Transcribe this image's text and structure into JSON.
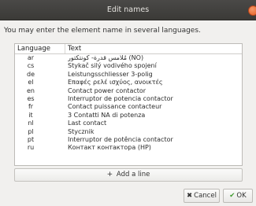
{
  "window": {
    "title": "Edit names"
  },
  "prompt": "You may enter the element name in several languages.",
  "table": {
    "headers": {
      "language": "Language",
      "text": "Text"
    },
    "rows": [
      {
        "lang": "ar",
        "text": "مُلامس قدرة- كونتكتور (NO)"
      },
      {
        "lang": "cs",
        "text": "Stykač silý vodivého spojení"
      },
      {
        "lang": "de",
        "text": "Leistungsschliesser 3-polig"
      },
      {
        "lang": "el",
        "text": "Επαφές ρελέ ισχύος, ανοικτές"
      },
      {
        "lang": "en",
        "text": "Contact power contactor"
      },
      {
        "lang": "es",
        "text": "Interruptor de potencia contactor"
      },
      {
        "lang": "fr",
        "text": "Contact puissance contacteur"
      },
      {
        "lang": "it",
        "text": "3 Contatti NA di potenza"
      },
      {
        "lang": "nl",
        "text": "Last contact"
      },
      {
        "lang": "pl",
        "text": "Stycznik"
      },
      {
        "lang": "pt",
        "text": "Interruptor de potência contactor"
      },
      {
        "lang": "ru",
        "text": "Контакт контактора (НР)"
      }
    ]
  },
  "add_button": {
    "icon": "plus-icon",
    "label": "Add a line"
  },
  "buttons": {
    "cancel": {
      "icon": "cancel-x-icon",
      "label": "Cancel"
    },
    "ok": {
      "icon": "checkmark-icon",
      "label": "OK"
    }
  },
  "colors": {
    "titlebar": "#3b3a37",
    "close": "#e55b1e",
    "ok_check": "#3b9a2a"
  }
}
